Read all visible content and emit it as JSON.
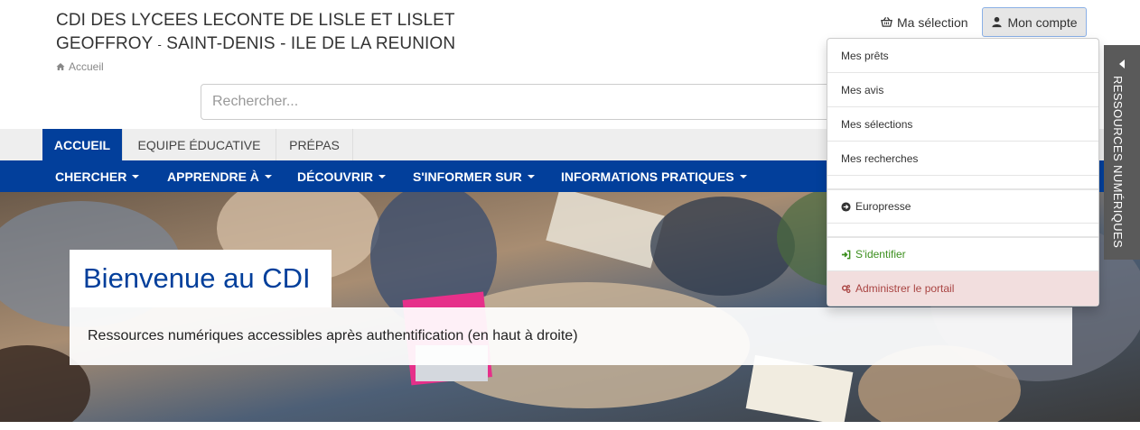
{
  "header": {
    "title_line1": "CDI DES LYCEES LECONTE DE LISLE ET LISLET",
    "title_line2a": "GEOFFROY",
    "title_dash": "-",
    "title_line2b": "SAINT-DENIS - ILE DE LA REUNION",
    "breadcrumb": "Accueil"
  },
  "search": {
    "placeholder": "Rechercher..."
  },
  "top_actions": {
    "selection_label": "Ma sélection",
    "account_label": "Mon compte"
  },
  "account_menu": [
    {
      "label": "Mes prêts"
    },
    {
      "label": "Mes avis"
    },
    {
      "label": "Mes sélections"
    },
    {
      "label": "Mes recherches"
    },
    {
      "label": "Europresse",
      "icon": "circle-arrow-right-icon"
    },
    {
      "label": "S'identifier",
      "icon": "sign-in-icon"
    },
    {
      "label": "Administrer le portail",
      "icon": "cogs-icon"
    }
  ],
  "tabs": [
    {
      "label": "ACCUEIL",
      "active": true
    },
    {
      "label": "EQUIPE ÉDUCATIVE"
    },
    {
      "label": "PRÉPAS"
    }
  ],
  "nav": [
    {
      "label": "CHERCHER"
    },
    {
      "label": "APPRENDRE À"
    },
    {
      "label": "DÉCOUVRIR"
    },
    {
      "label": "S'INFORMER SUR"
    },
    {
      "label": "INFORMATIONS PRATIQUES"
    }
  ],
  "hero": {
    "title": "Bienvenue au CDI",
    "subtitle": "Ressources numériques accessibles après authentification (en haut à droite)"
  },
  "side_panel": {
    "label": "RESSOURCES NUMÉRIQUES"
  },
  "colors": {
    "primary": "#023f9b",
    "admin_bg": "#f2dede",
    "admin_text": "#a94442",
    "login_text": "#3c8f1e"
  }
}
